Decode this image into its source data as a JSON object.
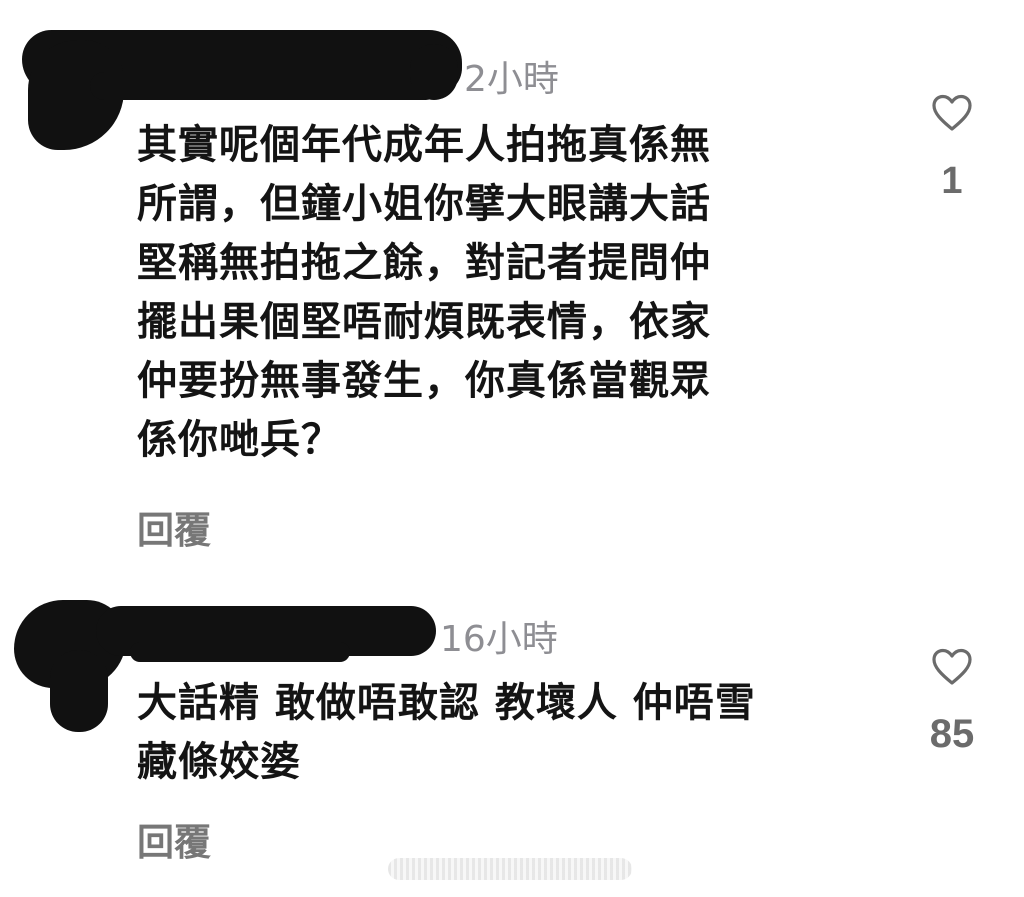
{
  "comments": [
    {
      "time": "2小時",
      "text": "其實呢個年代成年人拍拖真係無\n所謂，但鐘小姐你擘大眼講大話\n堅稱無拍拖之餘，對記者提問仲\n擺出果個堅唔耐煩既表情，依家\n仲要扮無事發生，你真係當觀眾\n係你哋兵？",
      "reply_label": "回覆",
      "like_count": "1"
    },
    {
      "time": "16小時",
      "text": "大話精 敢做唔敢認 教壞人 仲唔雪\n藏條姣婆",
      "reply_label": "回覆",
      "like_count": "85"
    }
  ],
  "icons": {
    "like": "heart-outline-icon"
  },
  "colors": {
    "text": "#141414",
    "meta": "#8e8e93",
    "reply": "#777777",
    "like_count": "#6b6b6b"
  }
}
